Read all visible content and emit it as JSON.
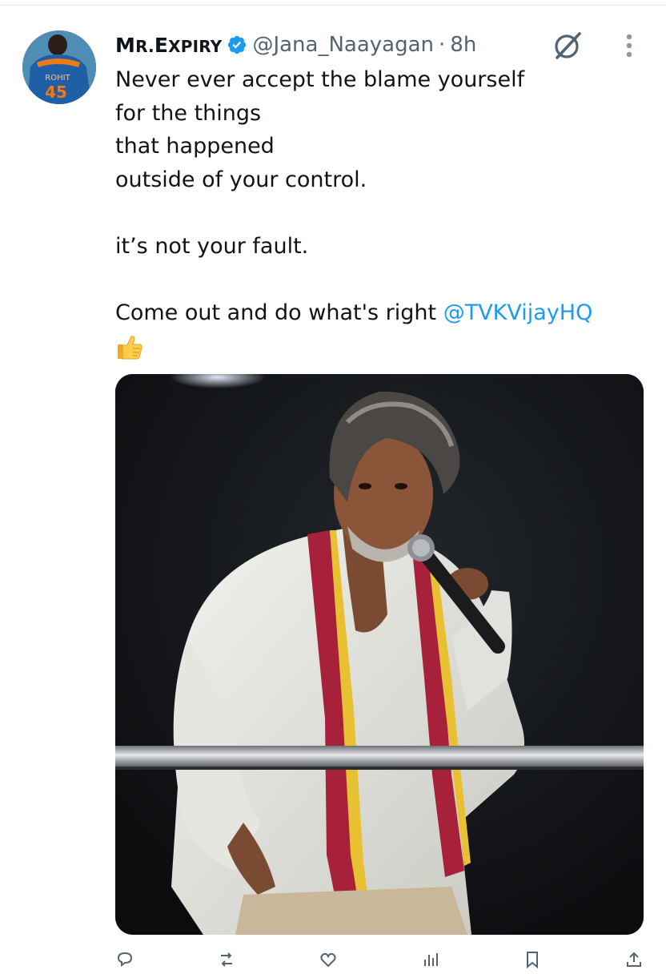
{
  "tweet": {
    "author": {
      "display_name_initial_1": "M",
      "display_name_mid": "R.",
      "display_name_initial_2": "E",
      "display_name_rest": "XPIRY",
      "handle": "@Jana_Naayagan",
      "separator": "·",
      "timestamp": "8h",
      "verified": true,
      "avatar_jersey_name": "ROHIT",
      "avatar_jersey_number": "45"
    },
    "text_lines": [
      "Never ever accept the blame yourself",
      "for the things",
      "that happened",
      "outside of your control.",
      "",
      "it’s not your fault.",
      "",
      "Come out and do what's right "
    ],
    "mention": "@TVKVijayHQ",
    "emoji": "thumbs-up",
    "icons": {
      "verified": "verified-badge-icon",
      "grok": "grok-icon",
      "more": "more-vertical-icon"
    },
    "colors": {
      "accent": "#1d9bf0",
      "text": "#0f1419",
      "secondary": "#536471"
    }
  }
}
